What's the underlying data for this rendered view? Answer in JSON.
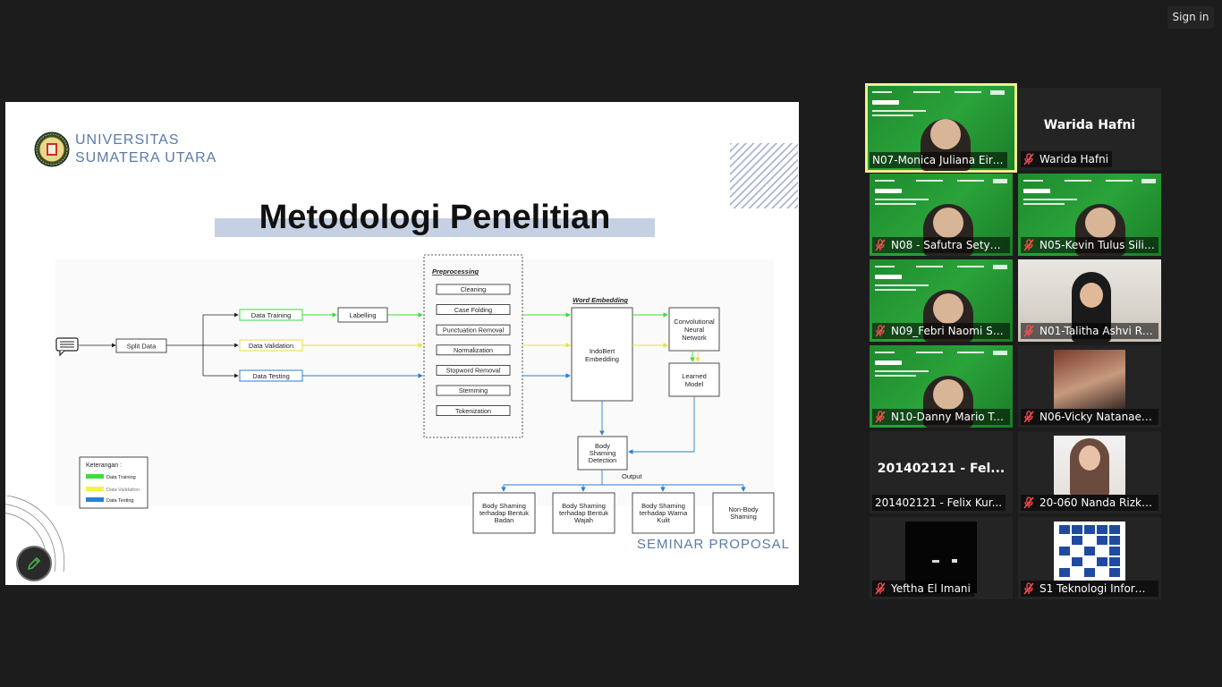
{
  "header": {
    "signin_label": "Sign in"
  },
  "slide": {
    "university_line1": "UNIVERSITAS",
    "university_line2": "SUMATERA UTARA",
    "title": "Metodologi Penelitian",
    "footer": "SEMINAR PROPOSAL",
    "diagram": {
      "split": "Split Data",
      "data_training": "Data Training",
      "data_validation": "Data Validation",
      "data_testing": "Data Testing",
      "labelling": "Labelling",
      "preprocessing_title": "Preprocessing",
      "steps": [
        "Cleaning",
        "Case Folding",
        "Punctuation Removal",
        "Normalization",
        "Stopword Removal",
        "Stemming",
        "Tokenization"
      ],
      "word_embedding_title": "Word Embedding",
      "indobert_1": "IndoBert",
      "indobert_2": "Embedding",
      "cnn_1": "Convolutional",
      "cnn_2": "Neural",
      "cnn_3": "Network",
      "learned_1": "Learned",
      "learned_2": "Model",
      "detect_1": "Body",
      "detect_2": "Shaming",
      "detect_3": "Detection",
      "output": "Output",
      "out1": [
        "Body Shaming",
        "terhadap Bentuk",
        "Badan"
      ],
      "out2": [
        "Body Shaming",
        "terhadap Bentuk",
        "Wajah"
      ],
      "out3": [
        "Body Shaming",
        "terhadap Warna",
        "Kulit"
      ],
      "out4": [
        "Non-Body",
        "Shaming"
      ],
      "legend_title": "Keterangan :",
      "legend_training": "Data Training",
      "legend_validation": "Data Validation",
      "legend_testing": "Data Testing"
    }
  },
  "colors": {
    "training": "#3ddc3d",
    "validation": "#f5f24a",
    "testing": "#2a7fd4",
    "accent": "#5b7aa8"
  },
  "participants": [
    {
      "name": "N07-Monica Juliana Eire...",
      "type": "video-green",
      "muted": false,
      "active": true
    },
    {
      "name": "Warida Hafni",
      "type": "name-only",
      "big_name": "Warida Hafni",
      "muted": true
    },
    {
      "name": "N08 - Safutra Setya A...",
      "type": "video-green",
      "muted": true
    },
    {
      "name": "N05-Kevin Tulus Silito...",
      "type": "video-green",
      "muted": true
    },
    {
      "name": "N09_Febri Naomi Sof...",
      "type": "video-green",
      "muted": true
    },
    {
      "name": "N01-Talitha Ashvi Ray...",
      "type": "video-room",
      "muted": true
    },
    {
      "name": "N10-Danny Mario Tu...",
      "type": "video-green",
      "muted": true
    },
    {
      "name": "N06-Vicky Natanael S...",
      "type": "photo",
      "muted": true
    },
    {
      "name": "201402121 - Felix Kur...",
      "type": "name-only",
      "big_name": "201402121 - Fel...",
      "muted": false
    },
    {
      "name": "20-060 Nanda Rizki A...",
      "type": "photo",
      "muted": true
    },
    {
      "name": "Yeftha El Imani",
      "type": "photo-dark",
      "muted": true
    },
    {
      "name": "S1 Teknologi Informasi",
      "type": "photo-logo",
      "muted": true
    }
  ]
}
